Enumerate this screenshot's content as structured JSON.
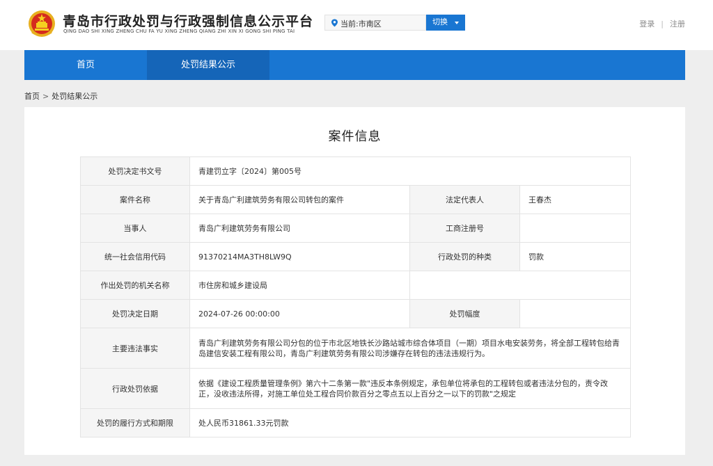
{
  "header": {
    "title": "青岛市行政处罚与行政强制信息公示平台",
    "pinyin": "QING DAO SHI XING ZHENG CHU FA YU XING ZHENG QIANG ZHI XIN XI GONG SHI PING TAI",
    "region_label": "当前:市南区",
    "switch_label": "切换",
    "login_label": "登录",
    "register_label": "注册",
    "accent_color": "#1976d2",
    "emblem_icon": "national-emblem-icon"
  },
  "nav": {
    "items": [
      {
        "label": "首页"
      },
      {
        "label": "处罚结果公示",
        "active": true
      }
    ]
  },
  "breadcrumb": {
    "home": "首页",
    "separator": ">",
    "current": "处罚结果公示"
  },
  "case": {
    "heading": "案件信息",
    "rows": {
      "decision_no": {
        "label": "处罚决定书文号",
        "value": "青建罚立字〔2024〕第005号"
      },
      "case_name": {
        "label": "案件名称",
        "value": "关于青岛广利建筑劳务有限公司转包的案件"
      },
      "legal_rep": {
        "label": "法定代表人",
        "value": "王春杰"
      },
      "party": {
        "label": "当事人",
        "value": "青岛广利建筑劳务有限公司"
      },
      "reg_no": {
        "label": "工商注册号",
        "value": ""
      },
      "credit_code": {
        "label": "统一社会信用代码",
        "value": "91370214MA3TH8LW9Q"
      },
      "penalty_type": {
        "label": "行政处罚的种类",
        "value": "罚款"
      },
      "authority": {
        "label": "作出处罚的机关名称",
        "value": "市住房和城乡建设局"
      },
      "decision_date": {
        "label": "处罚决定日期",
        "value": "2024-07-26 00:00:00"
      },
      "penalty_range": {
        "label": "处罚幅度",
        "value": ""
      },
      "facts": {
        "label": "主要违法事实",
        "value": "青岛广利建筑劳务有限公司分包的位于市北区地铁长沙路站城市综合体项目（一期）项目水电安装劳务，将全部工程转包给青岛建信安装工程有限公司，青岛广利建筑劳务有限公司涉嫌存在转包的违法违规行为。"
      },
      "basis": {
        "label": "行政处罚依据",
        "value": "依据《建设工程质量管理条例》第六十二条第一款\"违反本条例规定，承包单位将承包的工程转包或者违法分包的，责令改正，没收违法所得，对施工单位处工程合同价款百分之零点五以上百分之一以下的罚款\"之规定"
      },
      "performance": {
        "label": "处罚的履行方式和期限",
        "value": "处人民币31861.33元罚款"
      }
    }
  }
}
